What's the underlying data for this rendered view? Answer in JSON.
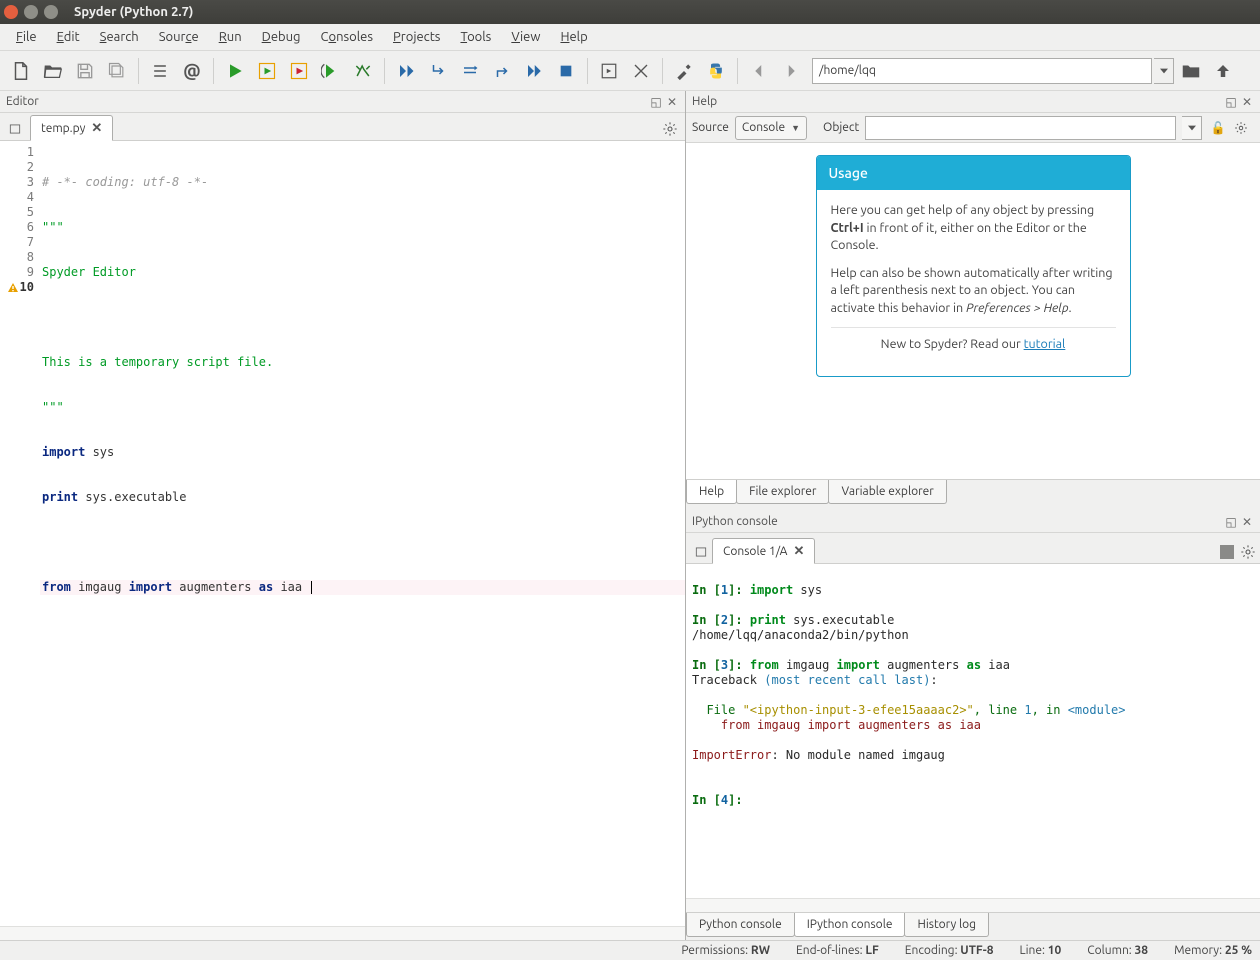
{
  "window": {
    "title": "Spyder (Python 2.7)"
  },
  "menu": [
    "File",
    "Edit",
    "Search",
    "Source",
    "Run",
    "Debug",
    "Consoles",
    "Projects",
    "Tools",
    "View",
    "Help"
  ],
  "path": "/home/lqq",
  "editor_pane_title": "Editor",
  "help_pane_title": "Help",
  "ipython_title": "IPython console",
  "editor_tab": "temp.py",
  "help": {
    "source_label": "Source",
    "source_value": "Console",
    "object_label": "Object",
    "card_title": "Usage",
    "para1a": "Here you can get help of any object by pressing ",
    "para1b": "Ctrl+I",
    "para1c": " in front of it, either on the Editor or the Console.",
    "para2a": "Help can also be shown automatically after writing a left parenthesis next to an object. You can activate this behavior in ",
    "para2b": "Preferences > Help",
    "para2c": ".",
    "newline": "New to Spyder? Read our ",
    "tutorial": "tutorial"
  },
  "help_tabs": [
    "Help",
    "File explorer",
    "Variable explorer"
  ],
  "code": {
    "l1_comment": "# -*- coding: utf-8 -*-",
    "l2": "\"\"\"",
    "l3": "Spyder Editor",
    "l5": "This is a temporary script file.",
    "l6": "\"\"\"",
    "l7a": "import",
    "l7b": " sys",
    "l8a": "print",
    "l8b": " sys.executable",
    "l10a": "from",
    "l10b": " imgaug ",
    "l10c": "import",
    "l10d": " augmenters ",
    "l10e": "as",
    "l10f": " iaa "
  },
  "console_tab": "Console 1/A",
  "console": {
    "in1p": "In [",
    "in1n": "1",
    "in1e": "]: ",
    "in1k": "import",
    "in1s": " sys",
    "in2p": "In [",
    "in2n": "2",
    "in2e": "]: ",
    "in2k": "print",
    "in2s": " sys.executable",
    "out2": "/home/lqq/anaconda2/bin/python",
    "in3p": "In [",
    "in3n": "3",
    "in3e": "]: ",
    "in3a": "from",
    "in3b": " imgaug ",
    "in3c": "import",
    "in3d": " augmenters ",
    "in3e2": "as",
    "in3f": " iaa",
    "tb1": "Traceback ",
    "tb2": "(most recent call last)",
    "tb3": ":",
    "f1": "  File ",
    "f2": "\"<ipython-input-3-efee15aaaac2>\"",
    "f3": ", line ",
    "f4": "1",
    "f5": ", in ",
    "f6": "<module>",
    "fsrc": "    from imgaug import augmenters as iaa",
    "err1": "ImportError",
    "err2": ": No module named imgaug",
    "in4p": "In [",
    "in4n": "4",
    "in4e": "]: "
  },
  "bottom_tabs": [
    "Python console",
    "IPython console",
    "History log"
  ],
  "status": {
    "perm_l": "Permissions:",
    "perm_v": "RW",
    "eol_l": "End-of-lines:",
    "eol_v": "LF",
    "enc_l": "Encoding:",
    "enc_v": "UTF-8",
    "line_l": "Line:",
    "line_v": "10",
    "col_l": "Column:",
    "col_v": "38",
    "mem_l": "Memory:",
    "mem_v": "25 %"
  }
}
